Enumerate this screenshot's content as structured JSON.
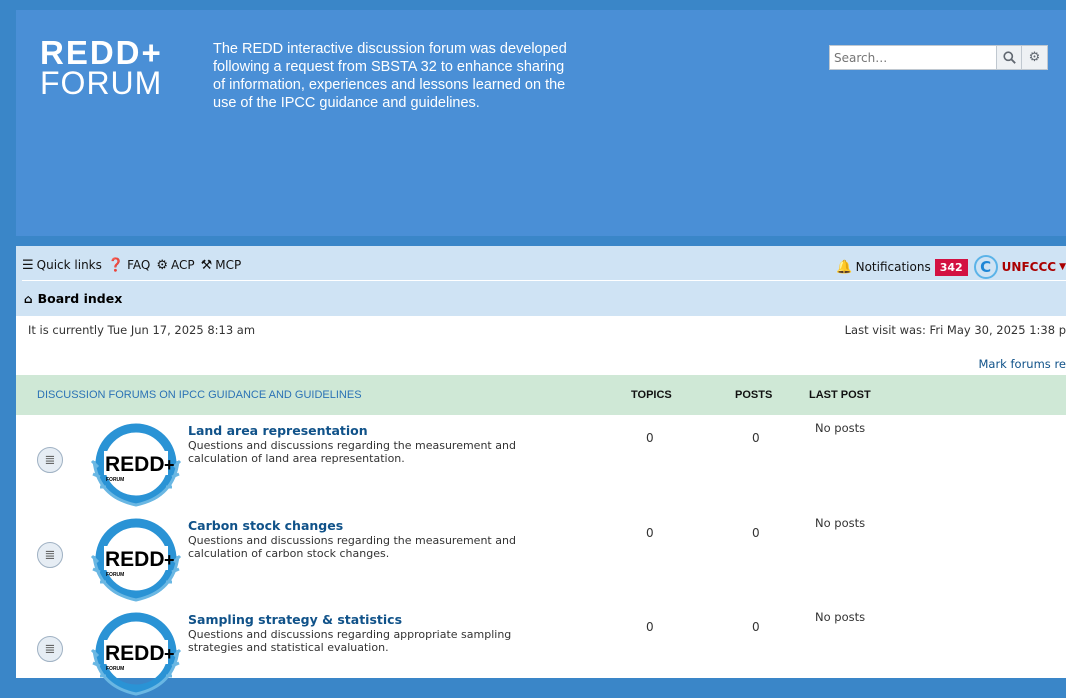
{
  "header": {
    "logo_line1": "REDD+",
    "logo_line2": "FORUM",
    "description": "The REDD interactive discussion forum was developed following a request from SBSTA 32 to enhance sharing of information, experiences and lessons learned on the use of the IPCC guidance and guidelines.",
    "search": {
      "placeholder": "Search…",
      "value": "Search…"
    }
  },
  "navbar": {
    "quick_links": "Quick links",
    "faq": "FAQ",
    "acp": "ACP",
    "mcp": "MCP",
    "notifications_label": "Notifications",
    "notifications_count": "342",
    "username": "UNFCCC"
  },
  "breadcrumb": {
    "board_index": "Board index"
  },
  "status": {
    "current_time": "It is currently Tue Jun 17, 2025 8:13 am",
    "last_visit": "Last visit was: Fri May 30, 2025 1:38 p",
    "mark_read": "Mark forums re"
  },
  "forum_table": {
    "category": "DISCUSSION FORUMS ON IPCC GUIDANCE AND GUIDELINES",
    "col_topics": "TOPICS",
    "col_posts": "POSTS",
    "col_last_post": "LAST POST",
    "rows": [
      {
        "title": "Land area representation",
        "description": "Questions and discussions regarding the measurement and calculation of land area representation.",
        "topics": "0",
        "posts": "0",
        "last_post": "No posts"
      },
      {
        "title": "Carbon stock changes",
        "description": "Questions and discussions regarding the measurement and calculation of carbon stock changes.",
        "topics": "0",
        "posts": "0",
        "last_post": "No posts"
      },
      {
        "title": "Sampling strategy & statistics",
        "description": "Questions and discussions regarding appropriate sampling strategies and statistical evaluation.",
        "topics": "0",
        "posts": "0",
        "last_post": "No posts"
      }
    ]
  },
  "forum_logo_text": {
    "main": "REDD",
    "plus": "+",
    "sub": "FORUM"
  },
  "colors": {
    "page_bg": "#3a86c8",
    "header_bg": "#4a8fd6",
    "navbar_bg": "#cfe3f4",
    "table_header_bg": "#cfe8d6",
    "link": "#105289",
    "badge": "#d31141"
  }
}
